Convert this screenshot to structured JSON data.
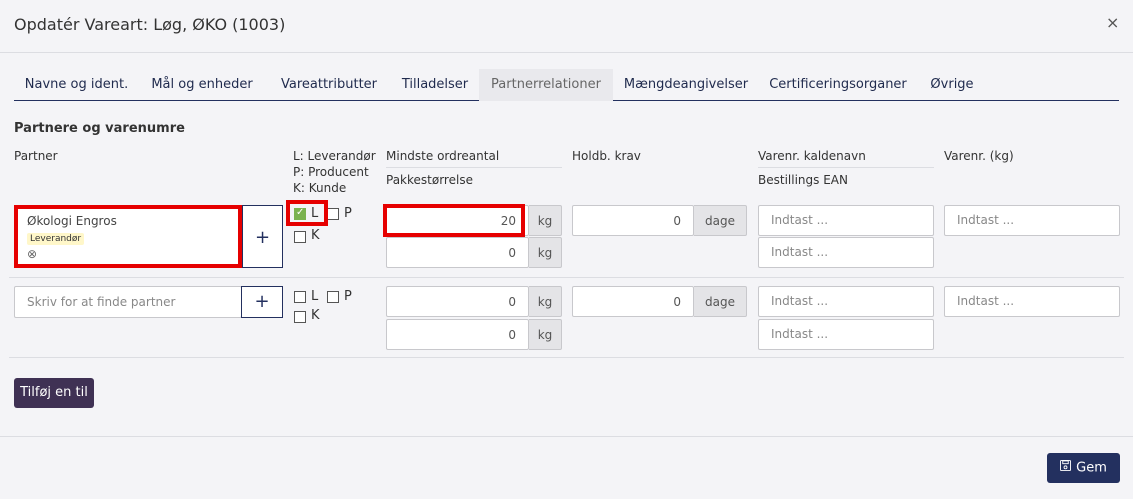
{
  "dialog": {
    "title": "Opdatér Vareart: Løg, ØKO (1003)",
    "close": "×"
  },
  "tabs": [
    {
      "label": "Navne og ident."
    },
    {
      "label": "Mål og enheder"
    },
    {
      "label": "Vareattributter"
    },
    {
      "label": "Tilladelser"
    },
    {
      "label": "Partnerrelationer",
      "active": true
    },
    {
      "label": "Mængdeangivelser"
    },
    {
      "label": "Certificeringsorganer"
    },
    {
      "label": "Øvrige"
    }
  ],
  "section": {
    "title": "Partnere og varenumre"
  },
  "columns": {
    "partner": "Partner",
    "legend": [
      "L: Leverandør",
      "P: Producent",
      "K: Kunde"
    ],
    "min_order": "Mindste ordreantal",
    "pack_size": "Pakkestørrelse",
    "shelf_life": "Holdb. krav",
    "item_call_name": "Varenr. kaldenavn",
    "order_ean": "Bestillings EAN",
    "item_kg": "Varenr. (kg)"
  },
  "rows": [
    {
      "partner_name": "Økologi Engros",
      "partner_badge": "Leverandør",
      "remove_icon": "⊗",
      "plus": "+",
      "L": {
        "label": "L",
        "checked": true
      },
      "P": {
        "label": "P",
        "checked": false
      },
      "K": {
        "label": "K",
        "checked": false
      },
      "min_order_value": "20",
      "min_order_unit": "kg",
      "pack_value": "0",
      "pack_unit": "kg",
      "shelf_value": "0",
      "shelf_unit": "dage",
      "call_name_placeholder": "Indtast ...",
      "ean_placeholder": "Indtast ...",
      "item_kg_placeholder": "Indtast ..."
    },
    {
      "partner_placeholder": "Skriv for at finde partner",
      "plus": "+",
      "L": {
        "label": "L",
        "checked": false
      },
      "P": {
        "label": "P",
        "checked": false
      },
      "K": {
        "label": "K",
        "checked": false
      },
      "min_order_value": "0",
      "min_order_unit": "kg",
      "pack_value": "0",
      "pack_unit": "kg",
      "shelf_value": "0",
      "shelf_unit": "dage",
      "call_name_placeholder": "Indtast ...",
      "ean_placeholder": "Indtast ...",
      "item_kg_placeholder": "Indtast ..."
    }
  ],
  "buttons": {
    "add": "Tilføj en til",
    "save": "Gem",
    "save_icon": "floppy-disk-icon"
  },
  "colors": {
    "primary": "#23305f",
    "add_button": "#3f3154",
    "highlight": "#e60000",
    "check": "#7ab24f"
  }
}
